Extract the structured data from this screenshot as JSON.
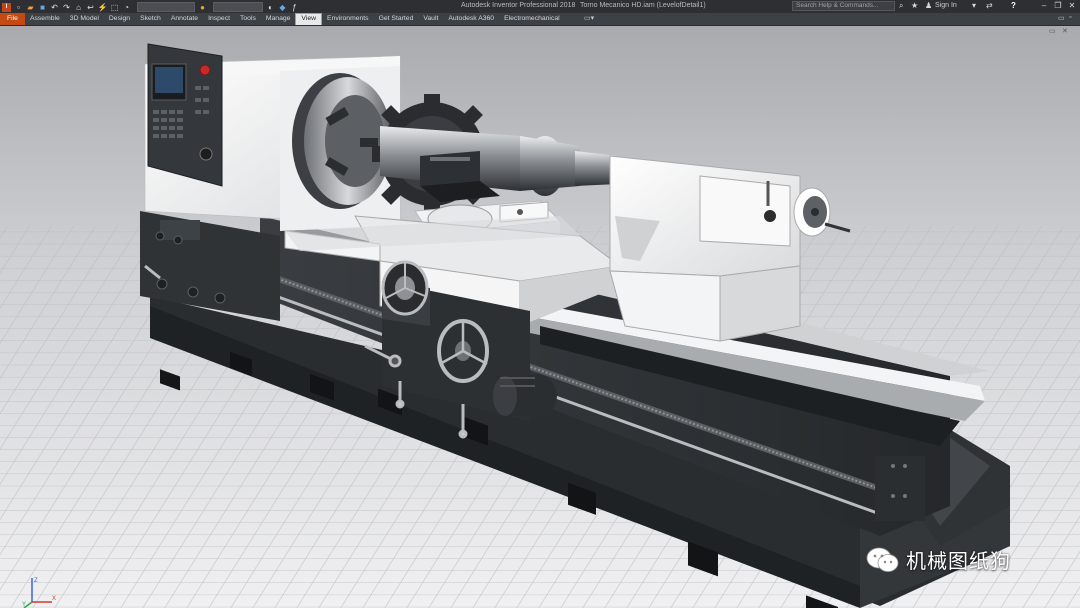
{
  "app": {
    "title": "Autodesk Inventor Professional 2018",
    "document": "Torno Mecanico HD.iam (LevelofDetail1)"
  },
  "titlebar": {
    "search_placeholder": "Search Help & Commands...",
    "sign_in": "Sign In",
    "help_label": "?"
  },
  "ribbon": {
    "file_tab": "File",
    "tabs": [
      "Assemble",
      "3D Model",
      "Design",
      "Sketch",
      "Annotate",
      "Inspect",
      "Tools",
      "Manage",
      "View",
      "Environments",
      "Get Started",
      "Vault",
      "Autodesk A360",
      "Electromechanical"
    ],
    "active_tab": "View"
  },
  "viewport": {
    "model_name": "lathe machine (Torno Mecanico HD)",
    "axis_labels": {
      "z": "Z",
      "x": "X",
      "y": "Y"
    }
  },
  "watermark": {
    "text": "机械图纸狗"
  },
  "colors": {
    "file_tab": "#c44a14",
    "titlebar": "#2d2f33",
    "ribbon": "#3d4045",
    "machine_dark": "#2f3336",
    "machine_light": "#eeeeee"
  }
}
